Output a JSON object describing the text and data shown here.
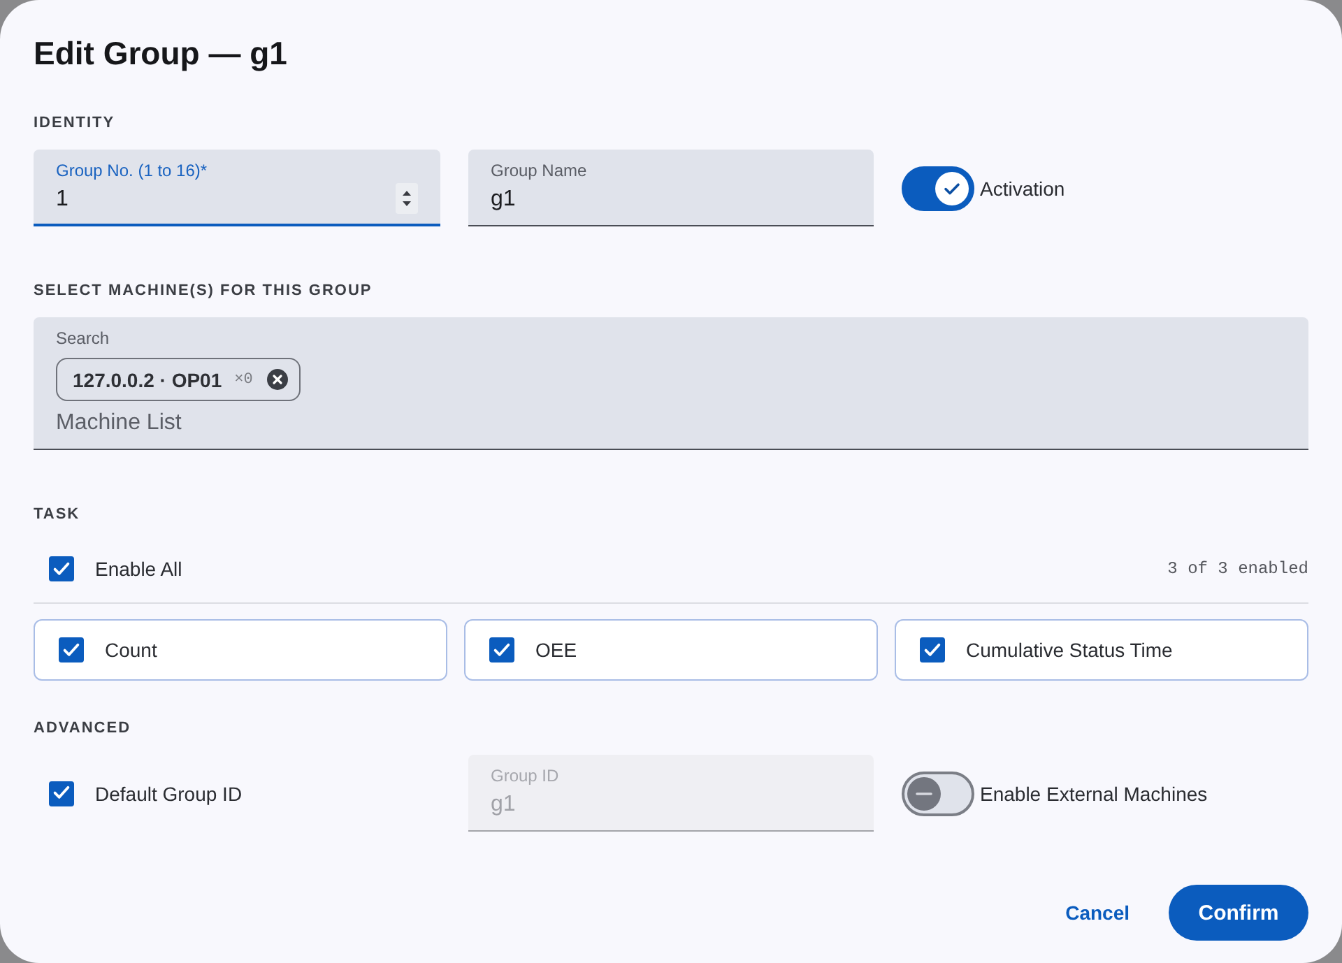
{
  "dialog": {
    "title": "Edit Group — g1"
  },
  "identity": {
    "heading": "IDENTITY",
    "group_no": {
      "label": "Group No. (1 to 16)*",
      "value": "1",
      "focused": true,
      "disabled": false
    },
    "group_name": {
      "label": "Group Name",
      "value": "g1",
      "focused": false,
      "disabled": false
    },
    "activation": {
      "label": "Activation",
      "on": true
    }
  },
  "machines": {
    "heading": "SELECT MACHINE(S) FOR THIS GROUP",
    "search": {
      "label": "Search",
      "placeholder": "Machine List",
      "chips": [
        {
          "label": "127.0.0.2 · OP01",
          "count": "×0"
        }
      ]
    }
  },
  "task": {
    "heading": "TASK",
    "enable_all": {
      "label": "Enable All",
      "checked": true
    },
    "summary": "3 of 3 enabled",
    "items": [
      {
        "label": "Count",
        "checked": true
      },
      {
        "label": "OEE",
        "checked": true
      },
      {
        "label": "Cumulative Status Time",
        "checked": true
      }
    ]
  },
  "advanced": {
    "heading": "ADVANCED",
    "default_group_id": {
      "label": "Default Group ID",
      "checked": true
    },
    "group_id": {
      "label": "Group ID",
      "value": "g1",
      "focused": false,
      "disabled": true
    },
    "external": {
      "label": "Enable External Machines",
      "on": false
    }
  },
  "buttons": [
    {
      "label": "Cancel",
      "kind": "text"
    },
    {
      "label": "Confirm",
      "kind": "primary"
    }
  ]
}
